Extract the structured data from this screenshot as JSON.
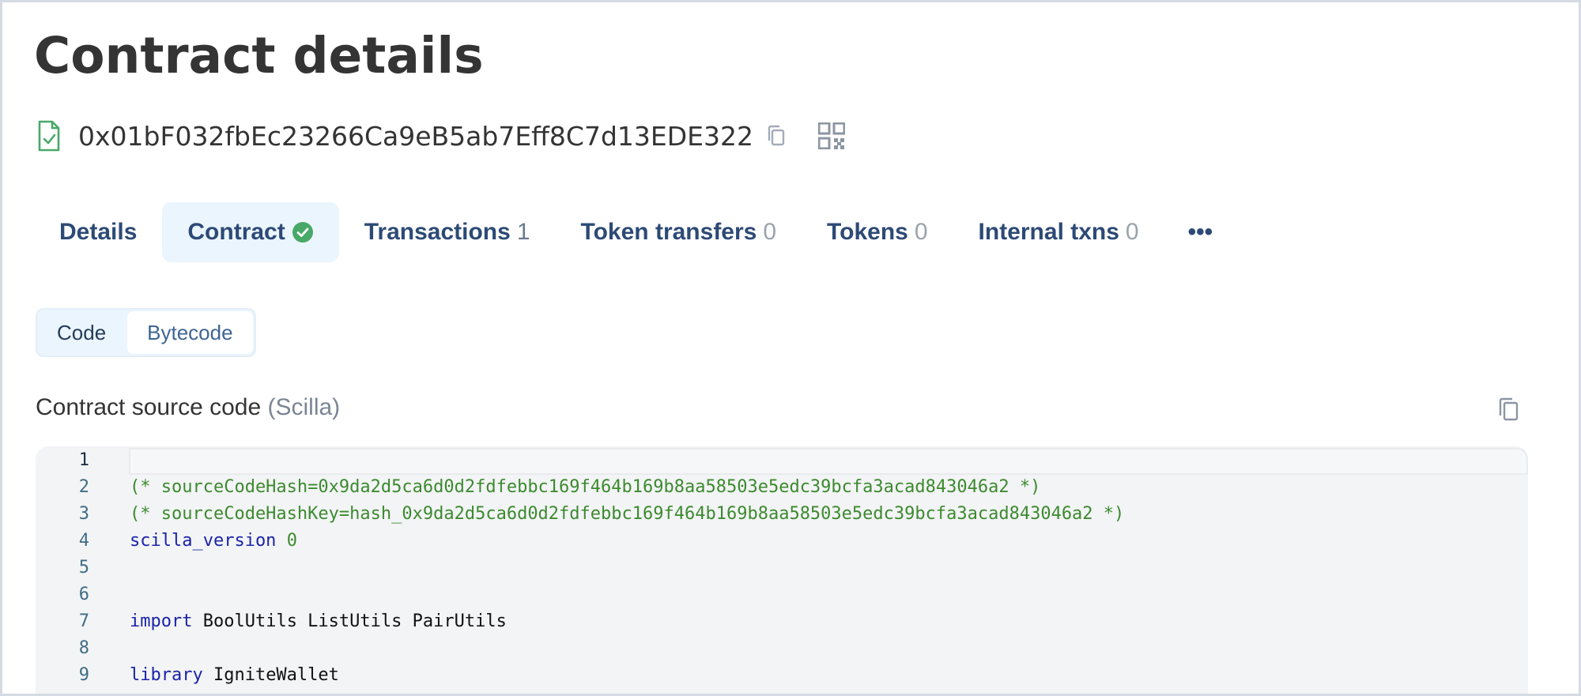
{
  "page": {
    "title": "Contract details"
  },
  "address": {
    "value": "0x01bF032fbEc23266Ca9eB5ab7Eff8C7d13EDE322",
    "icon": "contract-verified-icon"
  },
  "tabs": [
    {
      "label": "Details",
      "count": ""
    },
    {
      "label": "Contract",
      "count": "",
      "verified": true
    },
    {
      "label": "Transactions",
      "count": "1"
    },
    {
      "label": "Token transfers",
      "count": "0"
    },
    {
      "label": "Tokens",
      "count": "0"
    },
    {
      "label": "Internal txns",
      "count": "0"
    },
    {
      "label": "•••",
      "count": ""
    }
  ],
  "code_tabs": {
    "code": "Code",
    "bytecode": "Bytecode"
  },
  "source": {
    "title": "Contract source code",
    "language": "(Scilla)"
  },
  "code_lines": [
    {
      "n": "1",
      "text": ""
    },
    {
      "n": "2",
      "text": "(* sourceCodeHash=0x9da2d5ca6d0d2fdfebbc169f464b169b8aa58503e5edc39bcfa3acad843046a2 *)"
    },
    {
      "n": "3",
      "text": "(* sourceCodeHashKey=hash_0x9da2d5ca6d0d2fdfebbc169f464b169b8aa58503e5edc39bcfa3acad843046a2 *)"
    },
    {
      "n": "4",
      "kw": "scilla_version",
      "rest": " ",
      "num": "0"
    },
    {
      "n": "5",
      "text": ""
    },
    {
      "n": "6",
      "text": ""
    },
    {
      "n": "7",
      "kw": "import",
      "rest": " BoolUtils ListUtils PairUtils"
    },
    {
      "n": "8",
      "text": ""
    },
    {
      "n": "9",
      "kw": "library",
      "rest": " IgniteWallet"
    }
  ],
  "colors": {
    "tab_text": "#2d4a76",
    "tab_active_bg": "#ebf5fd",
    "verified_green": "#48a868",
    "comment_green": "#3c8a2e",
    "keyword_blue": "#1a23a8"
  }
}
